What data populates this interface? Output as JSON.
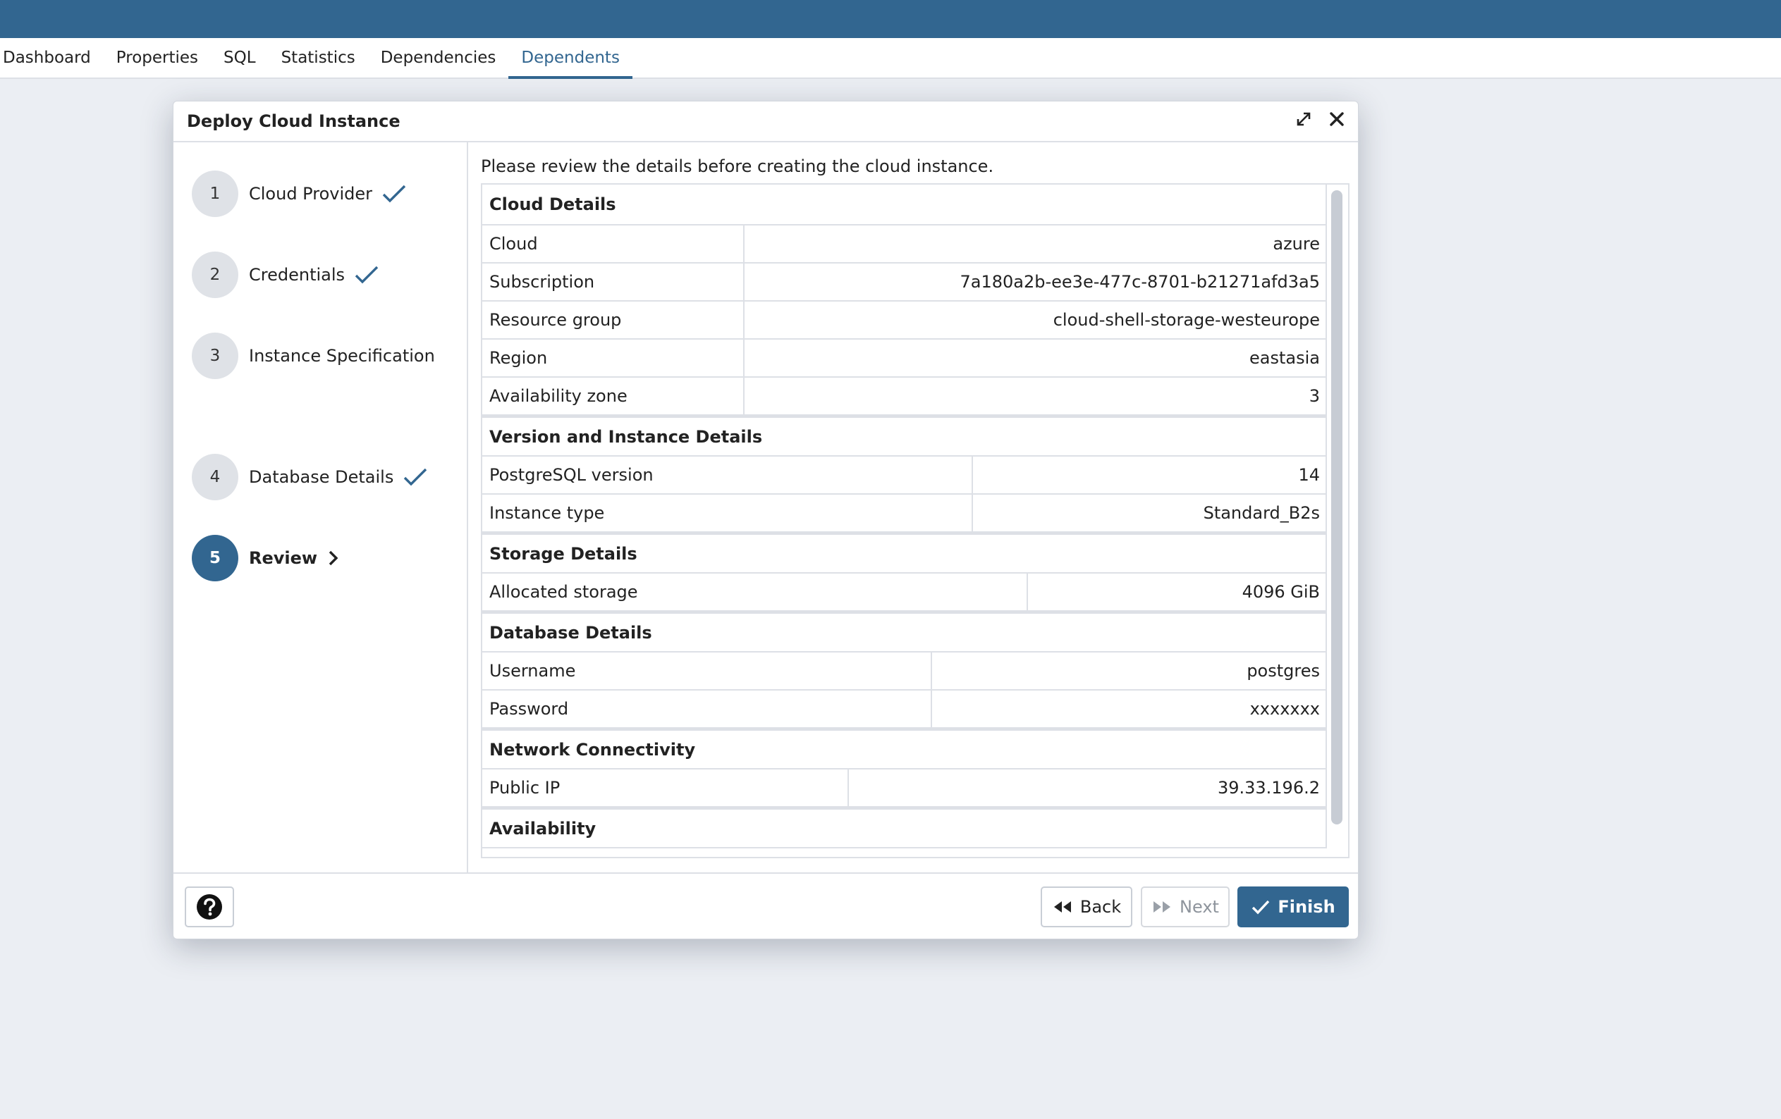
{
  "tabs": [
    {
      "label": "Dashboard"
    },
    {
      "label": "Properties"
    },
    {
      "label": "SQL"
    },
    {
      "label": "Statistics"
    },
    {
      "label": "Dependencies"
    },
    {
      "label": "Dependents",
      "active": true
    }
  ],
  "dialog": {
    "title": "Deploy Cloud Instance",
    "icons": {
      "maximize": "expand-icon",
      "close": "close-icon"
    },
    "steps": [
      {
        "number": "1",
        "label": "Cloud Provider",
        "status": "done"
      },
      {
        "number": "2",
        "label": "Credentials",
        "status": "done"
      },
      {
        "number": "3",
        "label": "Instance Specification",
        "status": "done"
      },
      {
        "number": "4",
        "label": "Database Details",
        "status": "done"
      },
      {
        "number": "5",
        "label": "Review",
        "status": "current"
      }
    ],
    "instruction": "Please review the details before creating the cloud instance.",
    "sections": [
      {
        "title": "Cloud Details",
        "rows": [
          {
            "key": "Cloud",
            "value": "azure"
          },
          {
            "key": "Subscription",
            "value": "7a180a2b-ee3e-477c-8701-b21271afd3a5"
          },
          {
            "key": "Resource group",
            "value": "cloud-shell-storage-westeurope"
          },
          {
            "key": "Region",
            "value": "eastasia"
          },
          {
            "key": "Availability zone",
            "value": "3"
          }
        ]
      },
      {
        "title": "Version and Instance Details",
        "rows": [
          {
            "key": "PostgreSQL version",
            "value": "14"
          },
          {
            "key": "Instance type",
            "value": "Standard_B2s"
          }
        ]
      },
      {
        "title": "Storage Details",
        "rows": [
          {
            "key": "Allocated storage",
            "value": "4096 GiB"
          }
        ]
      },
      {
        "title": "Database Details",
        "rows": [
          {
            "key": "Username",
            "value": "postgres"
          },
          {
            "key": "Password",
            "value": "xxxxxxx"
          }
        ]
      },
      {
        "title": "Network Connectivity",
        "rows": [
          {
            "key": "Public IP",
            "value": "39.33.196.2"
          }
        ]
      },
      {
        "title": "Availability",
        "rows": []
      }
    ],
    "footer": {
      "help_icon": "question-circle-icon",
      "back_label": "Back",
      "next_label": "Next",
      "finish_label": "Finish"
    }
  },
  "colors": {
    "brand": "#326690",
    "background": "#ebeef3",
    "border": "#dde0e6"
  }
}
